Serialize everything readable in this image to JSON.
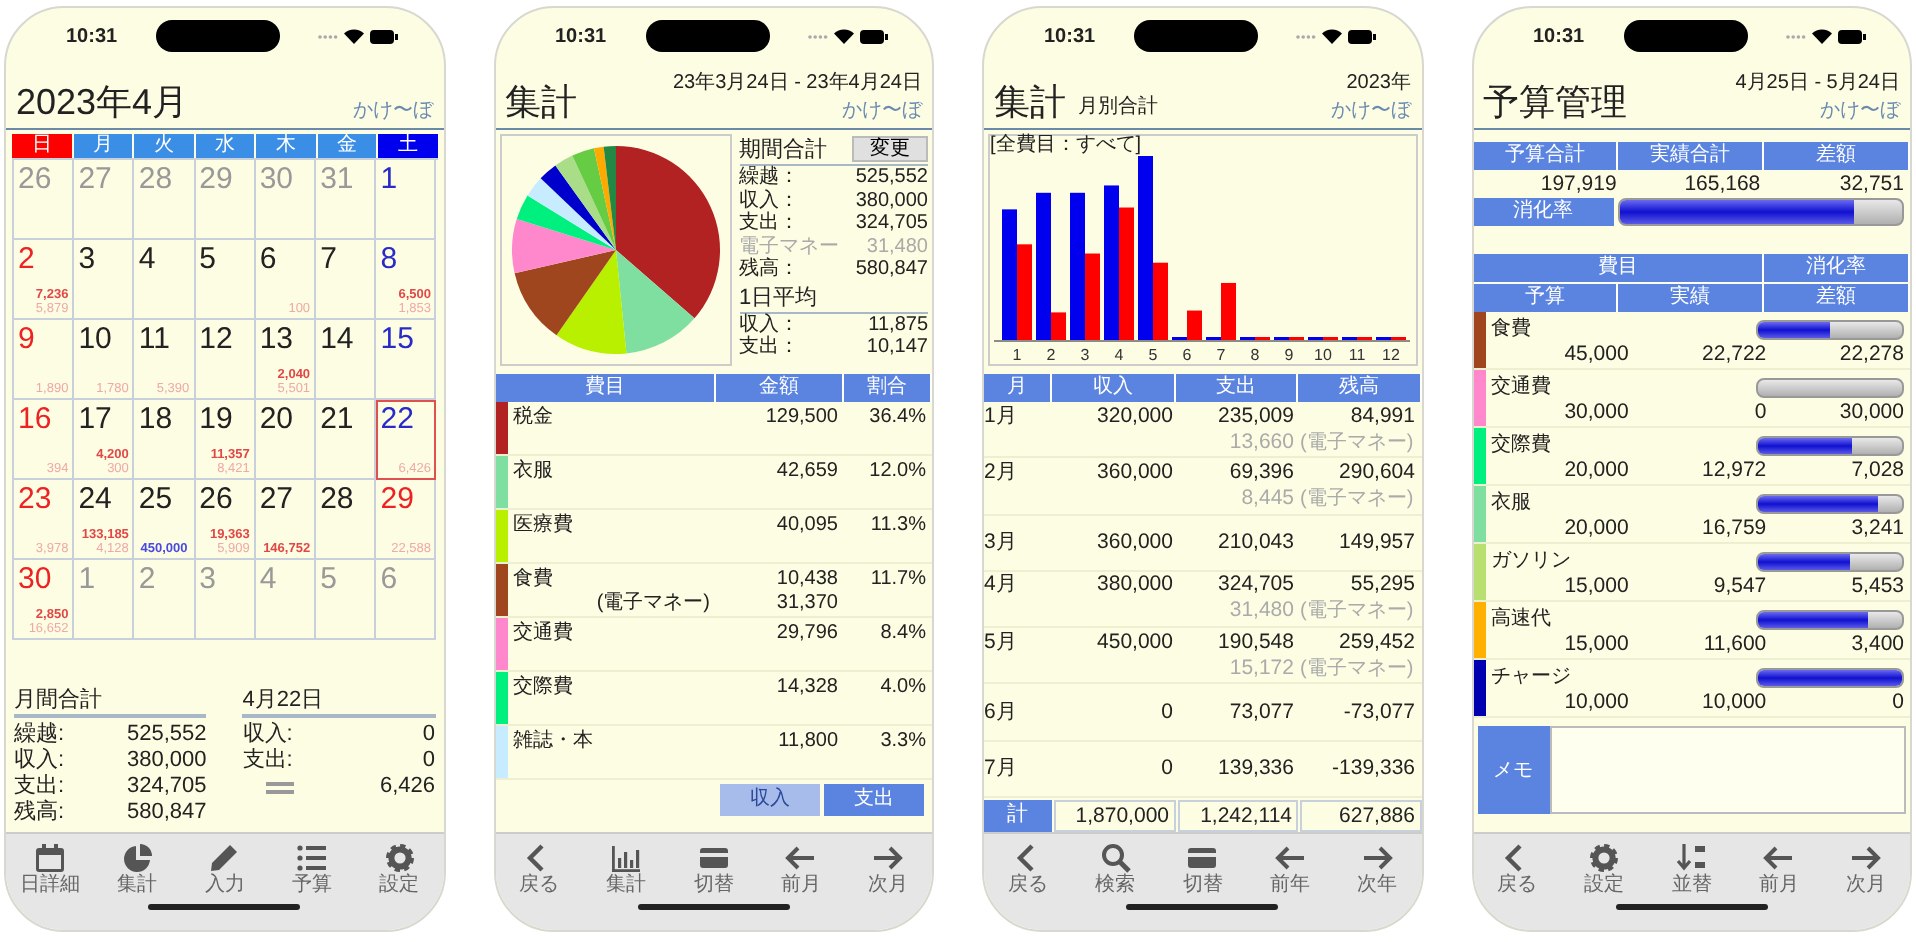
{
  "screens": [
    {
      "kind": "calendar",
      "time": "10:31",
      "title": "2023年4月",
      "app_name": "かけ〜ぼ",
      "weekdays": [
        {
          "label": "日",
          "color": "#ff0000"
        },
        {
          "label": "月",
          "color": "#3a8ee6"
        },
        {
          "label": "火",
          "color": "#3a8ee6"
        },
        {
          "label": "水",
          "color": "#3a8ee6"
        },
        {
          "label": "木",
          "color": "#3a8ee6"
        },
        {
          "label": "金",
          "color": "#3a8ee6"
        },
        {
          "label": "土",
          "color": "#0000ee"
        }
      ],
      "weeks": [
        [
          {
            "day": "26",
            "kind": "outside",
            "selected": false
          },
          {
            "day": "27",
            "kind": "outside",
            "selected": false
          },
          {
            "day": "28",
            "kind": "outside",
            "selected": false
          },
          {
            "day": "29",
            "kind": "outside",
            "selected": false
          },
          {
            "day": "30",
            "kind": "outside",
            "selected": false
          },
          {
            "day": "31",
            "kind": "outside",
            "selected": false
          },
          {
            "day": "1",
            "kind": "saturday",
            "selected": false
          }
        ],
        [
          {
            "day": "2",
            "kind": "sunday",
            "selected": false,
            "expense": "7,236",
            "sub_amount": "5,879"
          },
          {
            "day": "3",
            "kind": "weekday",
            "selected": false
          },
          {
            "day": "4",
            "kind": "weekday",
            "selected": false
          },
          {
            "day": "5",
            "kind": "weekday",
            "selected": false
          },
          {
            "day": "6",
            "kind": "weekday",
            "selected": false,
            "sub_amount": "100"
          },
          {
            "day": "7",
            "kind": "weekday",
            "selected": false
          },
          {
            "day": "8",
            "kind": "saturday",
            "selected": false,
            "expense": "6,500",
            "sub_amount": "1,853"
          }
        ],
        [
          {
            "day": "9",
            "kind": "sunday",
            "selected": false,
            "sub_amount": "1,890"
          },
          {
            "day": "10",
            "kind": "weekday",
            "selected": false,
            "sub_amount": "1,780"
          },
          {
            "day": "11",
            "kind": "weekday",
            "selected": false,
            "sub_amount": "5,390"
          },
          {
            "day": "12",
            "kind": "weekday",
            "selected": false
          },
          {
            "day": "13",
            "kind": "weekday",
            "selected": false,
            "expense": "2,040",
            "sub_amount": "5,501"
          },
          {
            "day": "14",
            "kind": "weekday",
            "selected": false
          },
          {
            "day": "15",
            "kind": "saturday",
            "selected": false
          }
        ],
        [
          {
            "day": "16",
            "kind": "sunday",
            "selected": false,
            "sub_amount": "394"
          },
          {
            "day": "17",
            "kind": "weekday",
            "selected": false,
            "expense": "4,200",
            "sub_amount": "300"
          },
          {
            "day": "18",
            "kind": "weekday",
            "selected": false
          },
          {
            "day": "19",
            "kind": "weekday",
            "selected": false,
            "expense": "11,357",
            "sub_amount": "8,421"
          },
          {
            "day": "20",
            "kind": "weekday",
            "selected": false
          },
          {
            "day": "21",
            "kind": "weekday",
            "selected": false
          },
          {
            "day": "22",
            "kind": "saturday",
            "selected": true,
            "sub_amount": "6,426"
          }
        ],
        [
          {
            "day": "23",
            "kind": "sunday",
            "selected": false,
            "sub_amount": "3,978"
          },
          {
            "day": "24",
            "kind": "weekday",
            "selected": false,
            "expense": "133,185",
            "sub_amount": "4,128"
          },
          {
            "day": "25",
            "kind": "weekday",
            "selected": false,
            "income": "450,000"
          },
          {
            "day": "26",
            "kind": "weekday",
            "selected": false,
            "expense": "19,363",
            "sub_amount": "5,909"
          },
          {
            "day": "27",
            "kind": "weekday",
            "selected": false,
            "expense": "146,752"
          },
          {
            "day": "28",
            "kind": "weekday",
            "selected": false
          },
          {
            "day": "29",
            "kind": "holiday",
            "selected": false,
            "sub_amount": "22,588"
          }
        ],
        [
          {
            "day": "30",
            "kind": "sunday",
            "selected": false,
            "expense": "2,850",
            "sub_amount": "16,652"
          },
          {
            "day": "1",
            "kind": "outside",
            "selected": false
          },
          {
            "day": "2",
            "kind": "outside",
            "selected": false
          },
          {
            "day": "3",
            "kind": "outside",
            "selected": false
          },
          {
            "day": "4",
            "kind": "outside",
            "selected": false
          },
          {
            "day": "5",
            "kind": "outside",
            "selected": false
          },
          {
            "day": "6",
            "kind": "outside",
            "selected": false
          }
        ]
      ],
      "month_total": {
        "title": "月間合計",
        "rows": [
          {
            "kind": "label",
            "label": "繰越:",
            "value": "525,552"
          },
          {
            "kind": "label",
            "label": "収入:",
            "value": "380,000"
          },
          {
            "kind": "label",
            "label": "支出:",
            "value": "324,705"
          },
          {
            "kind": "label",
            "label": "残高:",
            "value": "580,847"
          }
        ]
      },
      "day_total": {
        "title": "4月22日",
        "rows": [
          {
            "kind": "label",
            "label": "収入:",
            "value": "0"
          },
          {
            "kind": "label",
            "label": "支出:",
            "value": "0"
          },
          {
            "kind": "equals",
            "value": "6,426"
          }
        ]
      },
      "toolbar": [
        {
          "label": "日詳細",
          "kind": "calendar"
        },
        {
          "label": "集計",
          "kind": "pie"
        },
        {
          "label": "入力",
          "kind": "pencil"
        },
        {
          "label": "予算",
          "kind": "list"
        },
        {
          "label": "設定",
          "kind": "gear"
        }
      ]
    },
    {
      "kind": "summary",
      "time": "10:31",
      "title": "集計",
      "period": "23年3月24日 - 23年4月24日",
      "app_name": "かけ〜ぼ",
      "totals": {
        "title": "期間合計",
        "button": "変更",
        "rows": [
          {
            "kind": "main",
            "label": "繰越：",
            "value": "525,552"
          },
          {
            "kind": "main",
            "label": "収入：",
            "value": "380,000"
          },
          {
            "kind": "main",
            "label": "支出：",
            "value": "324,705"
          },
          {
            "kind": "sub",
            "label": "電子マネー",
            "value": "31,480"
          },
          {
            "kind": "main",
            "label": "残高：",
            "value": "580,847"
          }
        ]
      },
      "daily": {
        "title": "1日平均",
        "rows": [
          {
            "label": "収入：",
            "value": "11,875"
          },
          {
            "label": "支出：",
            "value": "10,147"
          }
        ]
      },
      "columns": [
        "費目",
        "金額",
        "割合"
      ],
      "rows": [
        {
          "name": "税金",
          "amount": "129,500",
          "share": "36.4%",
          "color": "#b22222"
        },
        {
          "name": "衣服",
          "amount": "42,659",
          "share": "12.0%",
          "color": "#7fdfa0"
        },
        {
          "name": "医療費",
          "amount": "40,095",
          "share": "11.3%",
          "color": "#b8f000"
        },
        {
          "name": "食費",
          "amount": "10,438",
          "share": "11.7%",
          "color": "#a0461e",
          "sub_label": "(電子マネー)",
          "sub_amount": "31,370"
        },
        {
          "name": "交通費",
          "amount": "29,796",
          "share": "8.4%",
          "color": "#ff88cc"
        },
        {
          "name": "交際費",
          "amount": "14,328",
          "share": "4.0%",
          "color": "#00f080"
        },
        {
          "name": "雑誌・本",
          "amount": "11,800",
          "share": "3.3%",
          "color": "#c8ecff"
        }
      ],
      "segments": [
        {
          "label": "収入",
          "selected": false
        },
        {
          "label": "支出",
          "selected": true
        }
      ],
      "toolbar": [
        {
          "label": "戻る",
          "kind": "back"
        },
        {
          "label": "集計",
          "kind": "bars"
        },
        {
          "label": "切替",
          "kind": "card"
        },
        {
          "label": "前月",
          "kind": "left"
        },
        {
          "label": "次月",
          "kind": "right"
        }
      ]
    },
    {
      "kind": "monthly",
      "time": "10:31",
      "title": "集計",
      "subtitle": "月別合計",
      "year": "2023年",
      "app_name": "かけ〜ぼ",
      "chart": {
        "title": "[全費目：すべて]",
        "axis_labels": [
          "1",
          "2",
          "3",
          "4",
          "5",
          "6",
          "7",
          "8",
          "9",
          "10",
          "11",
          "12"
        ]
      },
      "columns": [
        "月",
        "収入",
        "支出",
        "残高"
      ],
      "rows": [
        {
          "month": "1月",
          "income": "320,000",
          "expense": "235,009",
          "balance": "84,991",
          "sub_amount": "13,660",
          "sub_label": "(電子マネー)"
        },
        {
          "month": "2月",
          "income": "360,000",
          "expense": "69,396",
          "balance": "290,604",
          "sub_amount": "8,445",
          "sub_label": "(電子マネー)"
        },
        {
          "month": "3月",
          "income": "360,000",
          "expense": "210,043",
          "balance": "149,957"
        },
        {
          "month": "4月",
          "income": "380,000",
          "expense": "324,705",
          "balance": "55,295",
          "sub_amount": "31,480",
          "sub_label": "(電子マネー)"
        },
        {
          "month": "5月",
          "income": "450,000",
          "expense": "190,548",
          "balance": "259,452",
          "sub_amount": "15,172",
          "sub_label": "(電子マネー)"
        },
        {
          "month": "6月",
          "income": "0",
          "expense": "73,077",
          "balance": "-73,077"
        },
        {
          "month": "7月",
          "income": "0",
          "expense": "139,336",
          "balance": "-139,336"
        }
      ],
      "total": {
        "label": "計",
        "income": "1,870,000",
        "expense": "1,242,114",
        "balance": "627,886"
      },
      "toolbar": [
        {
          "label": "戻る",
          "kind": "back"
        },
        {
          "label": "検索",
          "kind": "search"
        },
        {
          "label": "切替",
          "kind": "card"
        },
        {
          "label": "前年",
          "kind": "left"
        },
        {
          "label": "次年",
          "kind": "right"
        }
      ]
    },
    {
      "kind": "budget",
      "time": "10:31",
      "title": "予算管理",
      "period": "4月25日 - 5月24日",
      "app_name": "かけ〜ぼ",
      "summary_columns": [
        "予算合計",
        "実績合計",
        "差額"
      ],
      "summary_values": [
        "197,919",
        "165,168",
        "32,751"
      ],
      "rate_label": "消化率",
      "level": 0.83,
      "header_1": [
        "費目",
        "消化率"
      ],
      "header_2": [
        "予算",
        "実績",
        "差額"
      ],
      "rows": [
        {
          "name": "食費",
          "color": "#a0461e",
          "level": 0.5,
          "budget": "45,000",
          "actual": "22,722",
          "difference": "22,278"
        },
        {
          "name": "交通費",
          "color": "#ff88cc",
          "level": 0,
          "budget": "30,000",
          "actual": "0",
          "difference": "30,000"
        },
        {
          "name": "交際費",
          "color": "#00f080",
          "level": 0.65,
          "budget": "20,000",
          "actual": "12,972",
          "difference": "7,028"
        },
        {
          "name": "衣服",
          "color": "#7fdfa0",
          "level": 0.84,
          "budget": "20,000",
          "actual": "16,759",
          "difference": "3,241"
        },
        {
          "name": "ガソリン",
          "color": "#b8e070",
          "level": 0.64,
          "budget": "15,000",
          "actual": "9,547",
          "difference": "5,453"
        },
        {
          "name": "高速代",
          "color": "#ffb000",
          "level": 0.77,
          "budget": "15,000",
          "actual": "11,600",
          "difference": "3,400"
        },
        {
          "name": "チャージ",
          "color": "#0000b0",
          "level": 1,
          "budget": "10,000",
          "actual": "10,000",
          "difference": "0"
        }
      ],
      "memo_label": "メモ",
      "toolbar": [
        {
          "label": "戻る",
          "kind": "back"
        },
        {
          "label": "設定",
          "kind": "gear"
        },
        {
          "label": "並替",
          "kind": "sort"
        },
        {
          "label": "前月",
          "kind": "left"
        },
        {
          "label": "次月",
          "kind": "right"
        }
      ]
    }
  ]
}
